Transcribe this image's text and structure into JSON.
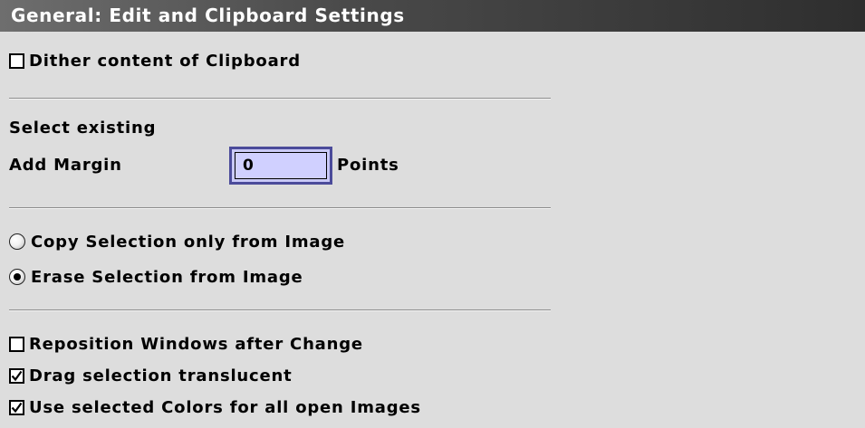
{
  "window": {
    "title": "General: Edit and Clipboard Settings"
  },
  "clipboard": {
    "dither": {
      "label": "Dither content of Clipboard",
      "checked": false
    }
  },
  "selection": {
    "select_existing_label": "Select existing",
    "add_margin_label": "Add Margin",
    "margin_value": "0",
    "margin_unit": "Points"
  },
  "cut_mode": {
    "options": [
      {
        "label": "Copy Selection only from Image",
        "selected": false
      },
      {
        "label": "Erase Selection from Image",
        "selected": true
      }
    ]
  },
  "options": {
    "reposition": {
      "label": "Reposition Windows after Change",
      "checked": false
    },
    "drag_translucent": {
      "label": "Drag selection translucent",
      "checked": true
    },
    "use_colors": {
      "label": "Use selected Colors for all open Images",
      "checked": true
    }
  },
  "colors": {
    "background": "#dddddd",
    "title_bar": "#3a3a3a",
    "input_border": "#4b4b9a",
    "input_fill": "#d0d0ff"
  }
}
